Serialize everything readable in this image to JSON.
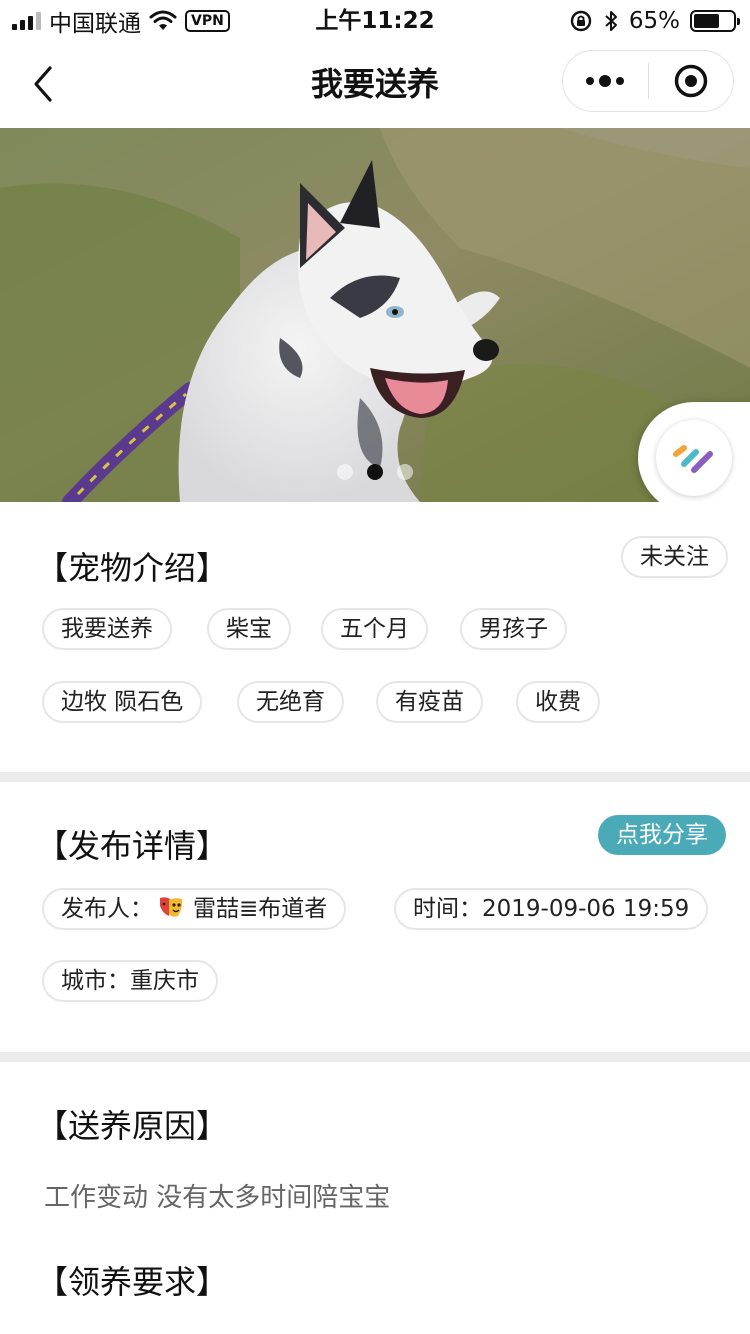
{
  "status_bar": {
    "carrier": "中国联通",
    "vpn": "VPN",
    "time": "上午11:22",
    "battery": "65%",
    "battery_level": 0.65
  },
  "nav": {
    "title": "我要送养"
  },
  "hero": {
    "slide_count": 3,
    "active_slide": 2
  },
  "pet_intro": {
    "title": "【宠物介绍】",
    "follow_label": "未关注",
    "tags": [
      "我要送养",
      "柴宝",
      "五个月",
      "男孩子",
      "边牧 陨石色",
      "无绝育",
      "有疫苗",
      "收费"
    ]
  },
  "publish": {
    "title": "【发布详情】",
    "share_label": "点我分享",
    "publisher_label": "发布人：",
    "publisher_name": "雷喆≣布道者",
    "time_label": "时间：",
    "time_value": "2019-09-06 19:59",
    "city_label": "城市：",
    "city_value": "重庆市"
  },
  "reason": {
    "title": "【送养原因】",
    "text": "工作变动 没有太多时间陪宝宝"
  },
  "requirements": {
    "title": "【领养要求】"
  },
  "colors": {
    "accent": "#4aaab8",
    "divider": "#ececec",
    "tag_border": "#e6e6e6"
  }
}
